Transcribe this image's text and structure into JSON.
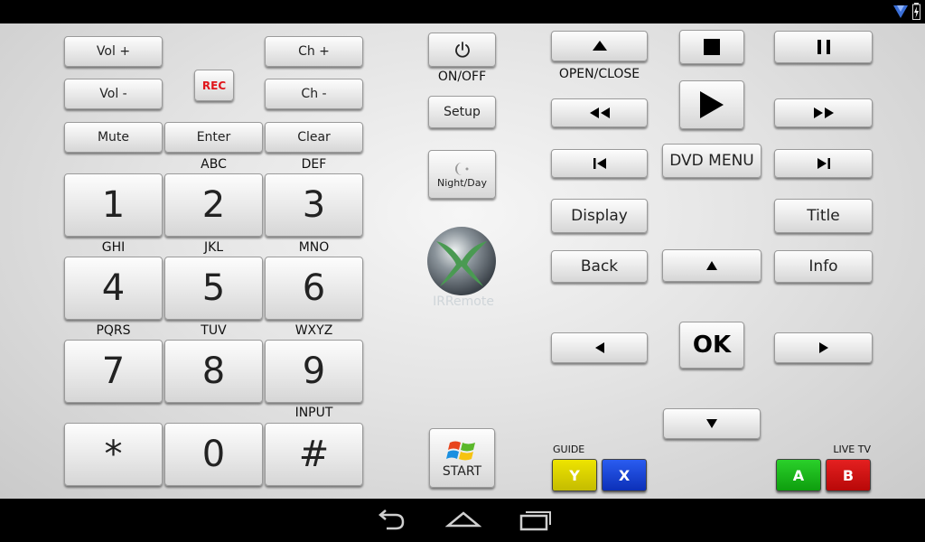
{
  "app": {
    "buttons": {
      "vol_up": "Vol +",
      "vol_down": "Vol -",
      "rec": "REC",
      "ch_up": "Ch +",
      "ch_down": "Ch -",
      "mute": "Mute",
      "enter": "Enter",
      "clear": "Clear",
      "setup": "Setup",
      "night_day": "Night/Day",
      "start": "START",
      "dvd_menu": "DVD MENU",
      "display": "Display",
      "title": "Title",
      "back": "Back",
      "info": "Info",
      "ok": "OK"
    },
    "labels": {
      "on_off": "ON/OFF",
      "open_close": "OPEN/CLOSE",
      "input": "INPUT",
      "guide": "GUIDE",
      "live_tv": "LIVE TV",
      "logo": "IRRemote"
    },
    "keypad": [
      {
        "key": "1",
        "letters": ""
      },
      {
        "key": "2",
        "letters": "ABC"
      },
      {
        "key": "3",
        "letters": "DEF"
      },
      {
        "key": "4",
        "letters": "GHI"
      },
      {
        "key": "5",
        "letters": "JKL"
      },
      {
        "key": "6",
        "letters": "MNO"
      },
      {
        "key": "7",
        "letters": "PQRS"
      },
      {
        "key": "8",
        "letters": "TUV"
      },
      {
        "key": "9",
        "letters": "WXYZ"
      },
      {
        "key": "*",
        "letters": ""
      },
      {
        "key": "0",
        "letters": ""
      },
      {
        "key": "#",
        "letters": ""
      }
    ],
    "color_buttons": {
      "y": "Y",
      "x": "X",
      "a": "A",
      "b": "B"
    },
    "colors": {
      "yellow": "#d8d000",
      "blue": "#1040d8",
      "green": "#18b818",
      "red": "#d01010",
      "rec_red": "#e0161b"
    },
    "icons": {
      "power": "power-icon",
      "night_day": "half-moon-icon",
      "windows": "windows-logo-icon",
      "eject": "eject-icon",
      "stop": "stop-icon",
      "pause": "pause-icon",
      "play": "play-icon",
      "rewind": "rewind-icon",
      "fast_forward": "fast-forward-icon",
      "prev": "skip-previous-icon",
      "next": "skip-next-icon",
      "up": "arrow-up-icon",
      "down": "arrow-down-icon",
      "left": "arrow-left-icon",
      "right": "arrow-right-icon",
      "nav_back": "nav-back-icon",
      "nav_home": "nav-home-icon",
      "nav_recents": "nav-recents-icon"
    }
  }
}
